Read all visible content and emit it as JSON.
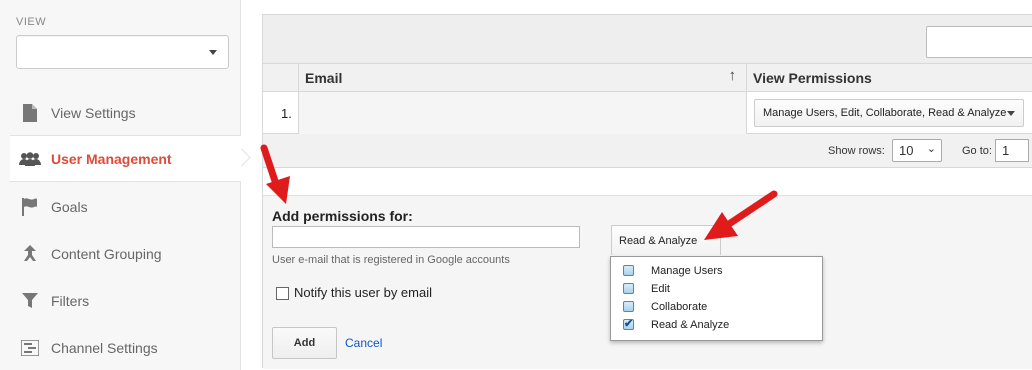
{
  "sidebar": {
    "view_label": "VIEW",
    "view_select_value": "",
    "items": [
      {
        "label": "View Settings",
        "icon": "document-icon",
        "active": false
      },
      {
        "label": "User Management",
        "icon": "users-icon",
        "active": true
      },
      {
        "label": "Goals",
        "icon": "flag-icon",
        "active": false
      },
      {
        "label": "Content Grouping",
        "icon": "grouping-icon",
        "active": false
      },
      {
        "label": "Filters",
        "icon": "filter-icon",
        "active": false
      },
      {
        "label": "Channel Settings",
        "icon": "channel-settings-icon",
        "active": false
      }
    ]
  },
  "toolbar": {
    "search_value": ""
  },
  "table": {
    "columns": [
      "Email",
      "View Permissions"
    ],
    "rows": [
      {
        "num": "1.",
        "email": "",
        "permissions": "Manage Users, Edit, Collaborate, Read & Analyze"
      }
    ]
  },
  "pager": {
    "rows_label": "Show rows:",
    "rows_value": "10",
    "goto_label": "Go to:",
    "goto_value": "1"
  },
  "add_permissions": {
    "title": "Add permissions for:",
    "email_value": "",
    "hint": "User e-mail that is registered in Google accounts",
    "notify_label": "Notify this user by email",
    "notify_checked": false,
    "add_button": "Add",
    "cancel_link": "Cancel",
    "permission_dropdown": "Read & Analyze",
    "permission_options": [
      {
        "label": "Manage Users",
        "checked": false
      },
      {
        "label": "Edit",
        "checked": false
      },
      {
        "label": "Collaborate",
        "checked": false
      },
      {
        "label": "Read & Analyze",
        "checked": true
      }
    ]
  },
  "colors": {
    "active_nav": "#dd4b39",
    "link": "#1155cc",
    "annotation_arrow": "#e01b1b"
  }
}
